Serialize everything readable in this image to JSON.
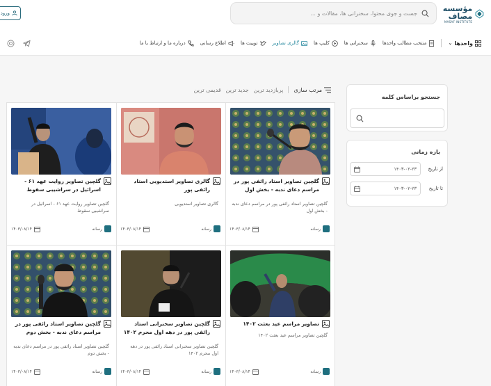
{
  "header": {
    "logo_text": "مؤسسه مصاف",
    "logo_en": "MASAF INSTITUTE",
    "search_placeholder": "جست و جوی محتوا، سخنرانی ها، مقالات و ...",
    "login_label": "ورود"
  },
  "nav": {
    "units_label": "واحدها",
    "items": [
      {
        "label": "منتخب مطالب واحدها",
        "icon": "document-icon"
      },
      {
        "label": "سخنرانی ها",
        "icon": "microphone-icon"
      },
      {
        "label": "کلیپ ها",
        "icon": "play-icon"
      },
      {
        "label": "گالری تصاویر",
        "icon": "gallery-icon"
      },
      {
        "label": "توییت ها",
        "icon": "bird-icon"
      },
      {
        "label": "اطلاع رسانی",
        "icon": "megaphone-icon"
      },
      {
        "label": "درباره ما و ارتباط با ما",
        "icon": "phone-icon"
      }
    ]
  },
  "sort": {
    "label": "مرتب سازی",
    "options": [
      "پربازدید ترین",
      "جدید ترین",
      "قدیمی ترین"
    ]
  },
  "sidebar": {
    "search_title": "جستجو براساس کلمه",
    "date_title": "بازه زمانی",
    "from_label": "از تاریخ",
    "to_label": "تا تاریخ",
    "from_value": "۱۴۰۳-۰۲-۲۳",
    "to_value": "۱۴۰۳-۰۲-۲۳"
  },
  "cards": [
    {
      "title": "گلچین تصاویر استاد رائفی پور در مراسم دعای ندبه - بخش اول",
      "desc": "گلچین تصاویر استاد رائفی پور در مراسم دعای ندبه - بخش اول",
      "date": "۱۴۰۳/۰۸/۱۴",
      "author": "رسانه"
    },
    {
      "title": "گالری تصاویر استدیویی استاد رائفی پور",
      "desc": "گالری تصاویر استدیویی",
      "date": "۱۴۰۳/۰۸/۱۴",
      "author": "رسانه"
    },
    {
      "title": "گلچین تصاویر روایت عهد ۶۱ - اسرائیل در سراشیبی سقوط",
      "desc": "گلچین تصاویر روایت عهد ۶۱ - اسرائیل در سراشیبی سقوط",
      "date": "۱۴۰۳/۰۸/۱۴",
      "author": "رسانه"
    },
    {
      "title": "تصاویر مراسم عید بعثت ۱۴۰۲",
      "desc": "گلچین تصاویر مراسم عید بعثت ۱۴۰۲",
      "date": "۱۴۰۳/۰۸/۱۴",
      "author": "رسانه"
    },
    {
      "title": "گلچین تصاویر سخنرانی استاد رائفی پور در دهه اول محرم ۱۴۰۲",
      "desc": "گلچین تصاویر سخنرانی استاد رائفی پور در دهه اول محرم ۱۴۰۲",
      "date": "۱۴۰۳/۰۸/۱۴",
      "author": "رسانه"
    },
    {
      "title": "گلچین تصاویر استاد رائفی پور در مراسم دعای ندبه - بخش دوم",
      "desc": "گلچین تصاویر استاد رائفی پور در مراسم دعای ندبه - بخش دوم",
      "date": "۱۴۰۳/۰۸/۱۴",
      "author": "رسانه"
    }
  ],
  "colors": {
    "brand": "#1f6f7f",
    "accent": "#2a8aa0",
    "text": "#222222"
  }
}
